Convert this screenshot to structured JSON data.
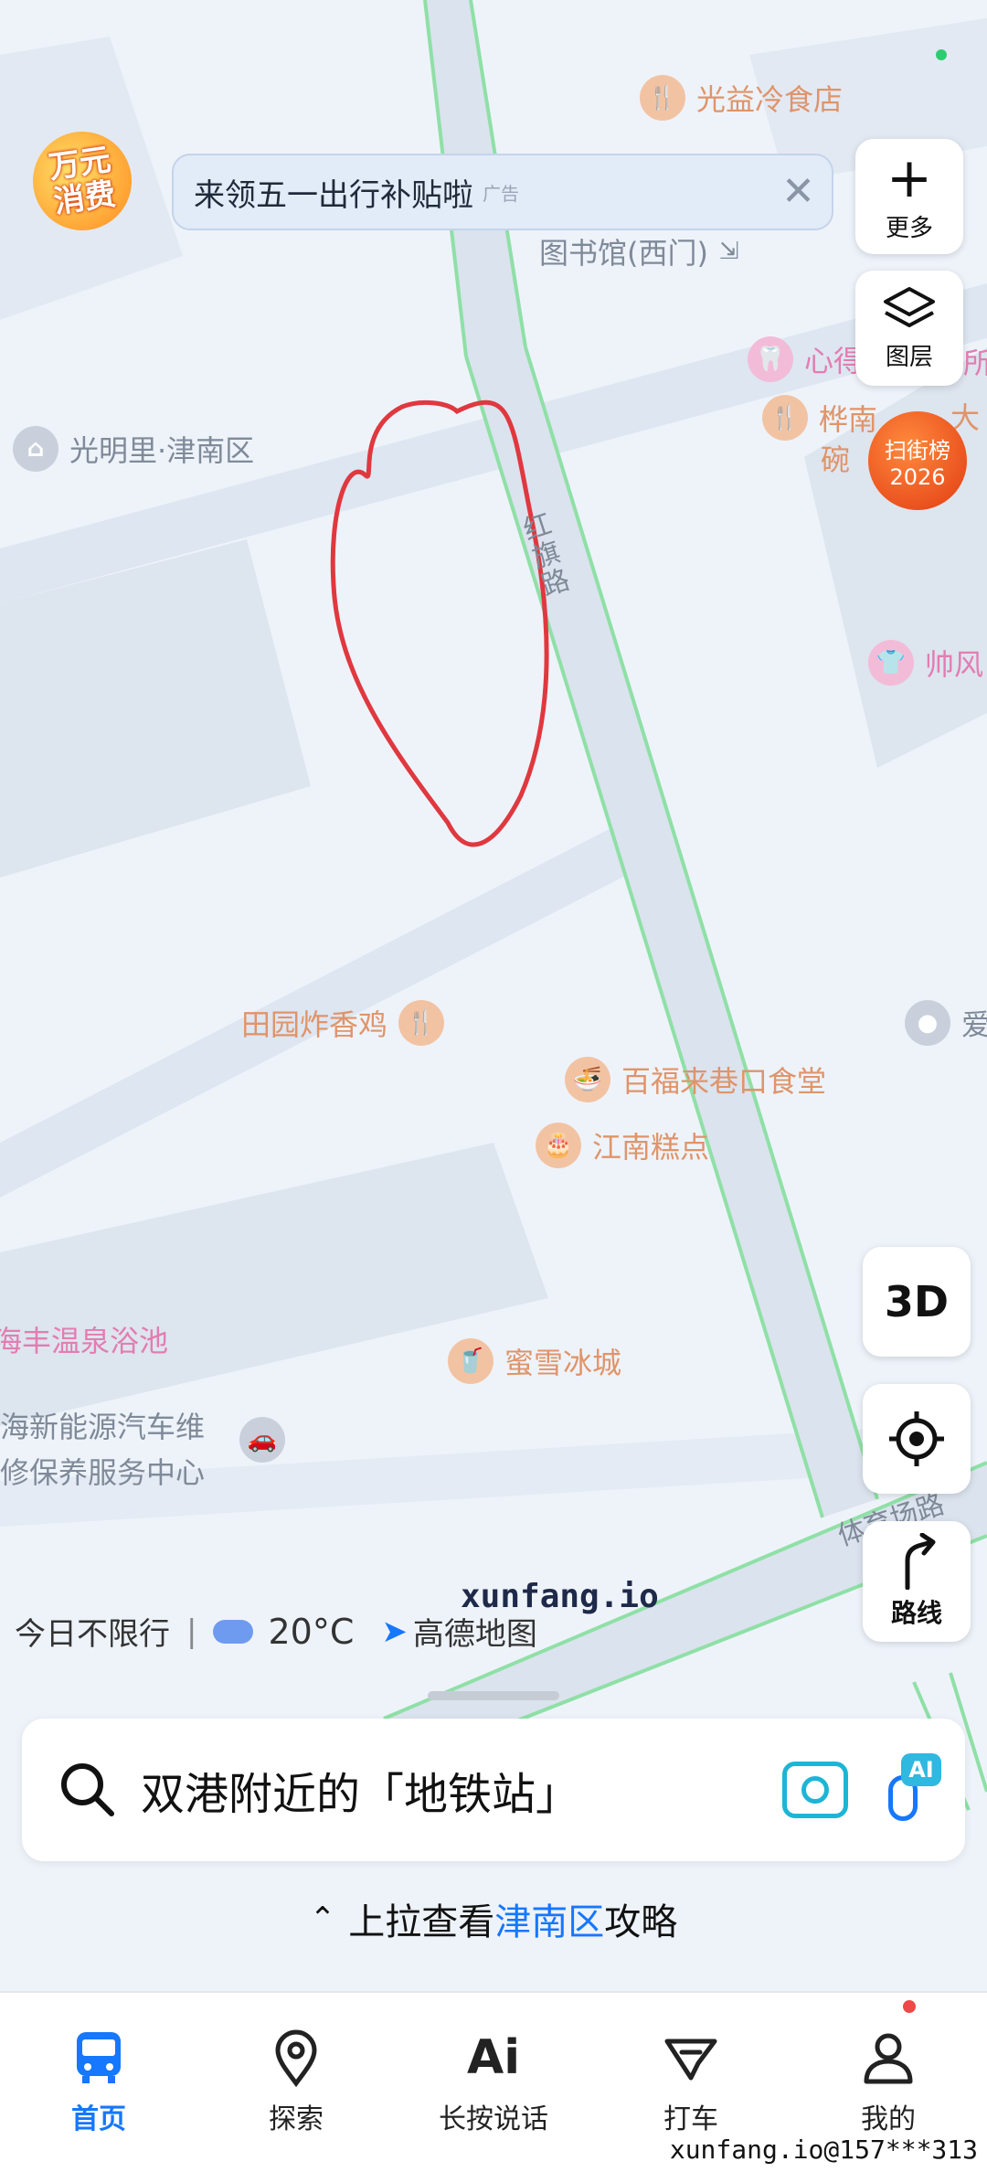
{
  "status": {
    "dot_color": "#2ecc71"
  },
  "promo": {
    "logo_line1": "万元",
    "logo_line2": "消费"
  },
  "banner": {
    "text": "来领五一出行补贴啦",
    "ad_tag": "广告"
  },
  "side": {
    "more_label": "更多",
    "layers_label": "图层",
    "ranking_line1": "扫街榜",
    "ranking_line2": "2026",
    "three_d": "3D",
    "route_label": "路线"
  },
  "map": {
    "pois": [
      {
        "label": "光益冷食店",
        "icon": "fork-knife-icon"
      },
      {
        "label": "图书馆(西门)",
        "icon": "entrance-icon"
      },
      {
        "label": "心得",
        "icon": "tooth-icon"
      },
      {
        "label": "所",
        "icon": "text"
      },
      {
        "label": "光明里·津南区",
        "icon": "house-icon"
      },
      {
        "label": "桦南",
        "icon": "fork-knife-icon"
      },
      {
        "label": "大",
        "icon": "text"
      },
      {
        "label": "碗",
        "icon": "text"
      },
      {
        "label": "帅风",
        "icon": "shirt-icon"
      },
      {
        "label": "田园炸香鸡",
        "icon": "fork-knife-icon"
      },
      {
        "label": "百福来巷口食堂",
        "icon": "bowl-icon"
      },
      {
        "label": "江南糕点",
        "icon": "cake-icon"
      },
      {
        "label": "爱",
        "icon": "dot-icon"
      },
      {
        "label": "海丰温泉浴池",
        "icon": "none"
      },
      {
        "label": "蜜雪冰城",
        "icon": "cup-icon"
      },
      {
        "label": "海新能源汽车维",
        "icon": "none"
      },
      {
        "label": "修保养服务中心",
        "icon": "car-icon"
      }
    ],
    "roads": {
      "hongqi": "红旗路",
      "tiyuchang": "体育场路"
    },
    "watermark": "xunfang.io",
    "restriction": "今日不限行",
    "temperature": "20°C",
    "brand": "高德地图"
  },
  "search": {
    "placeholder": "双港附近的「地铁站」",
    "ai_badge": "AI"
  },
  "pullup": {
    "prefix": "上拉查看",
    "district": "津南区",
    "suffix": "攻略"
  },
  "tabs": [
    {
      "label": "首页",
      "icon": "bus-icon",
      "active": true
    },
    {
      "label": "探索",
      "icon": "location-pin-icon",
      "active": false
    },
    {
      "label": "长按说话",
      "icon": "ai-voice-icon",
      "active": false
    },
    {
      "label": "打车",
      "icon": "taxi-icon",
      "active": false
    },
    {
      "label": "我的",
      "icon": "user-icon",
      "active": false
    }
  ],
  "footer_watermark": "xunfang.io@157***313",
  "colors": {
    "accent": "#1677ff",
    "annotation": "#e0383f",
    "pin_bg": "#f2c3a3"
  }
}
